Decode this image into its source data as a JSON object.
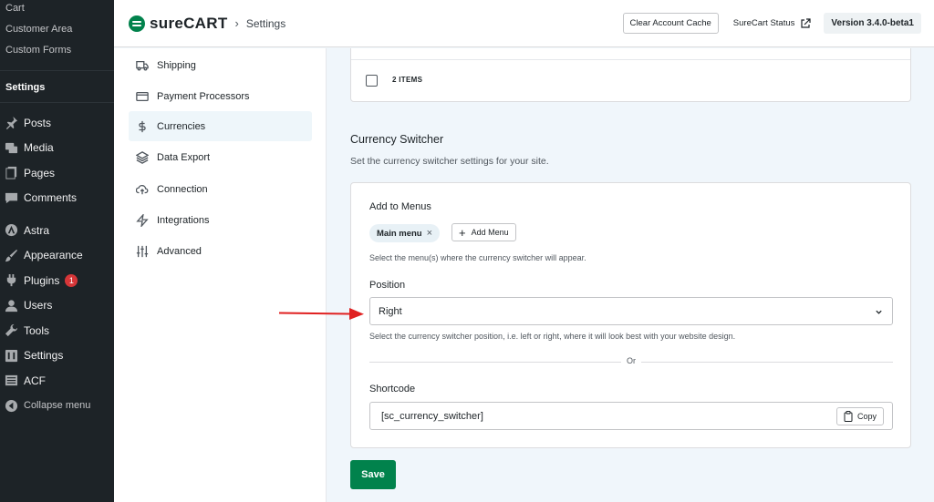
{
  "wp_sidebar": {
    "submenu": [
      "Cart",
      "Customer Area",
      "Custom Forms"
    ],
    "current": "Settings",
    "menu": [
      {
        "label": "Posts",
        "icon": "pin-icon"
      },
      {
        "label": "Media",
        "icon": "media-icon"
      },
      {
        "label": "Pages",
        "icon": "pages-icon"
      },
      {
        "label": "Comments",
        "icon": "comments-icon"
      },
      {
        "label": "Astra",
        "icon": "astra-icon"
      },
      {
        "label": "Appearance",
        "icon": "appearance-icon"
      },
      {
        "label": "Plugins",
        "icon": "plugins-icon",
        "badge": "1"
      },
      {
        "label": "Users",
        "icon": "users-icon"
      },
      {
        "label": "Tools",
        "icon": "tools-icon"
      },
      {
        "label": "Settings",
        "icon": "settings-icon"
      },
      {
        "label": "ACF",
        "icon": "acf-icon"
      }
    ],
    "collapse": "Collapse menu"
  },
  "header": {
    "logo": "sureCART",
    "breadcrumb": "Settings",
    "clear_cache": "Clear Account Cache",
    "status": "SureCart Status",
    "version": "Version 3.4.0-beta1"
  },
  "settings_nav": [
    {
      "label": "Shipping",
      "icon": "truck-icon"
    },
    {
      "label": "Payment Processors",
      "icon": "card-icon"
    },
    {
      "label": "Currencies",
      "icon": "dollar-icon",
      "active": true
    },
    {
      "label": "Data Export",
      "icon": "layers-icon"
    },
    {
      "label": "Connection",
      "icon": "cloud-upload-icon"
    },
    {
      "label": "Integrations",
      "icon": "zap-icon"
    },
    {
      "label": "Advanced",
      "icon": "sliders-icon"
    }
  ],
  "main": {
    "items_label": "2 ITEMS",
    "section_title": "Currency Switcher",
    "section_desc": "Set the currency switcher settings for your site.",
    "add_to_menus_label": "Add to Menus",
    "menu_tag": "Main menu",
    "add_menu_button": "Add Menu",
    "menus_help": "Select the menu(s) where the currency switcher will appear.",
    "position_label": "Position",
    "position_value": "Right",
    "position_help": "Select the currency switcher position, i.e. left or right, where it will look best with your website design.",
    "or_text": "Or",
    "shortcode_label": "Shortcode",
    "shortcode_value": "[sc_currency_switcher]",
    "copy_button": "Copy",
    "save_button": "Save"
  },
  "colors": {
    "brand_green": "#01824c",
    "annotation_red": "#e02020",
    "wp_dark": "#1d2327"
  }
}
